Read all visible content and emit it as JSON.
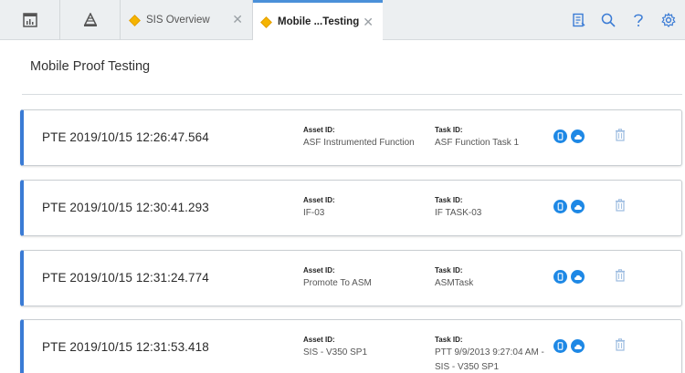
{
  "tabs": [
    {
      "label": "SIS Overview",
      "active": false
    },
    {
      "label": "Mobile ...Testing",
      "active": true
    }
  ],
  "page": {
    "title": "Mobile Proof Testing"
  },
  "labels": {
    "asset": "Asset ID:",
    "task": "Task ID:"
  },
  "records": [
    {
      "name": "PTE 2019/10/15 12:26:47.564",
      "asset_id": "ASF Instrumented Function",
      "task_id": "ASF Function Task 1"
    },
    {
      "name": "PTE 2019/10/15 12:30:41.293",
      "asset_id": "IF-03",
      "task_id": "IF TASK-03"
    },
    {
      "name": "PTE 2019/10/15 12:31:24.774",
      "asset_id": "Promote To ASM",
      "task_id": "ASMTask"
    },
    {
      "name": "PTE 2019/10/15 12:31:53.418",
      "asset_id": "SIS - V350 SP1",
      "task_id": "PTT 9/9/2013 9:27:04 AM - SIS - V350 SP1"
    }
  ],
  "colors": {
    "accent": "#3a7bd5",
    "tab_diamond": "#f5b400",
    "action_icon": "#1e88e5"
  },
  "icons": [
    "dashboard-icon",
    "asset-hierarchy-icon",
    "notes-icon",
    "search-icon",
    "help-icon",
    "settings-icon",
    "mobile-icon",
    "cloud-upload-icon",
    "trash-icon"
  ]
}
